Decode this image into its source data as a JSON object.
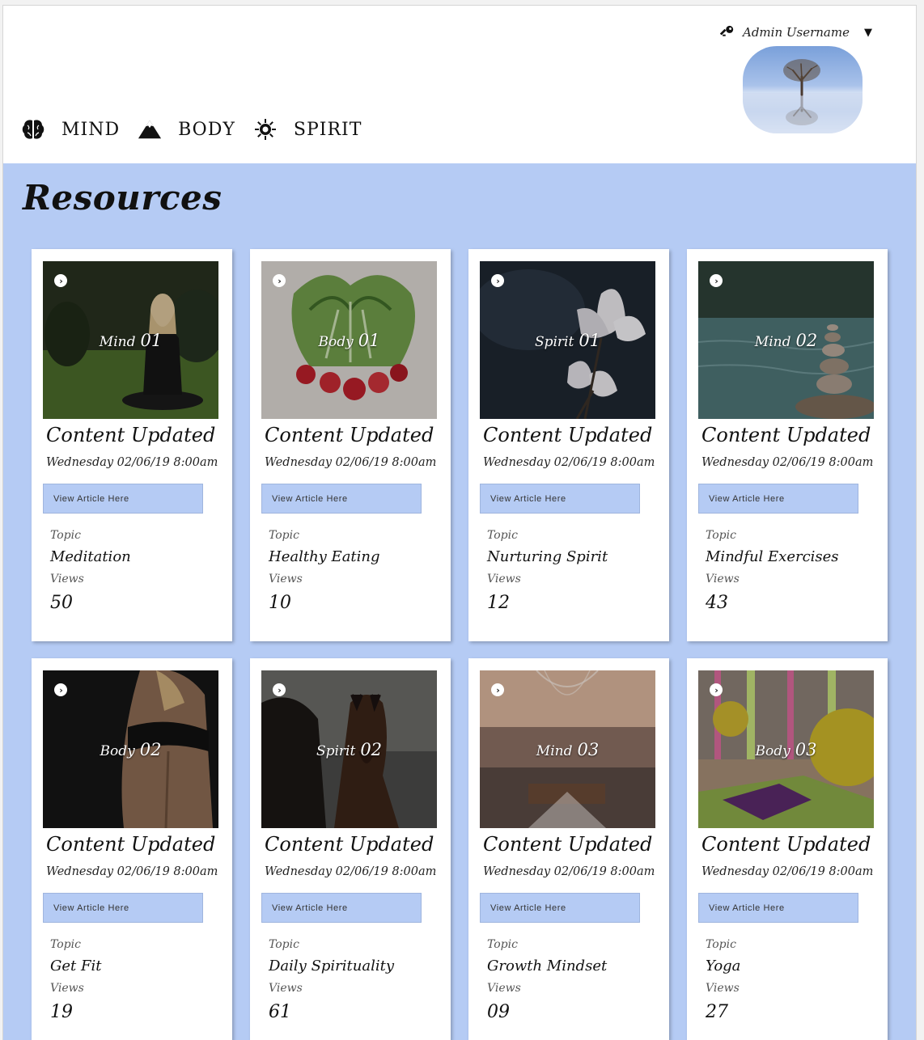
{
  "header": {
    "username": "Admin Username",
    "caret": "▼",
    "nav": [
      {
        "label": "MIND",
        "icon": "brain-icon"
      },
      {
        "label": "BODY",
        "icon": "mountain-icon"
      },
      {
        "label": "SPIRIT",
        "icon": "sun-icon"
      }
    ]
  },
  "page": {
    "title": "Resources"
  },
  "cards": [
    {
      "category": "Mind",
      "number": "01",
      "heading": "Content Updated",
      "date": "Wednesday 02/06/19 8:00am",
      "button": "View Article Here",
      "topic_label": "Topic",
      "topic": "Meditation",
      "views_label": "Views",
      "views": "50",
      "image": "meditation-photo"
    },
    {
      "category": "Body",
      "number": "01",
      "heading": "Content Updated",
      "date": "Wednesday 02/06/19 8:00am",
      "button": "View Article Here",
      "topic_label": "Topic",
      "topic": "Healthy Eating",
      "views_label": "Views",
      "views": "10",
      "image": "radishes-photo"
    },
    {
      "category": "Spirit",
      "number": "01",
      "heading": "Content Updated",
      "date": "Wednesday 02/06/19 8:00am",
      "button": "View Article Here",
      "topic_label": "Topic",
      "topic": "Nurturing Spirit",
      "views_label": "Views",
      "views": "12",
      "image": "magnolia-photo"
    },
    {
      "category": "Mind",
      "number": "02",
      "heading": "Content Updated",
      "date": "Wednesday 02/06/19 8:00am",
      "button": "View Article Here",
      "topic_label": "Topic",
      "topic": "Mindful Exercises",
      "views_label": "Views",
      "views": "43",
      "image": "stone-stack-photo"
    },
    {
      "category": "Body",
      "number": "02",
      "heading": "Content Updated",
      "date": "Wednesday 02/06/19 8:00am",
      "button": "View Article Here",
      "topic_label": "Topic",
      "topic": "Get Fit",
      "views_label": "Views",
      "views": "19",
      "image": "athlete-back-photo"
    },
    {
      "category": "Spirit",
      "number": "02",
      "heading": "Content Updated",
      "date": "Wednesday 02/06/19 8:00am",
      "button": "View Article Here",
      "topic_label": "Topic",
      "topic": "Daily Spirituality",
      "views_label": "Views",
      "views": "61",
      "image": "horses-photo"
    },
    {
      "category": "Mind",
      "number": "03",
      "heading": "Content Updated",
      "date": "Wednesday 02/06/19 8:00am",
      "button": "View Article Here",
      "topic_label": "Topic",
      "topic": "Growth Mindset",
      "views_label": "Views",
      "views": "09",
      "image": "namaste-photo"
    },
    {
      "category": "Body",
      "number": "03",
      "heading": "Content Updated",
      "date": "Wednesday 02/06/19 8:00am",
      "button": "View Article Here",
      "topic_label": "Topic",
      "topic": "Yoga",
      "views_label": "Views",
      "views": "27",
      "image": "yoga-mat-photo"
    }
  ],
  "colors": {
    "main_bg": "#b5cbf4",
    "button_bg": "#b5cbf4",
    "card_bg": "#ffffff"
  }
}
